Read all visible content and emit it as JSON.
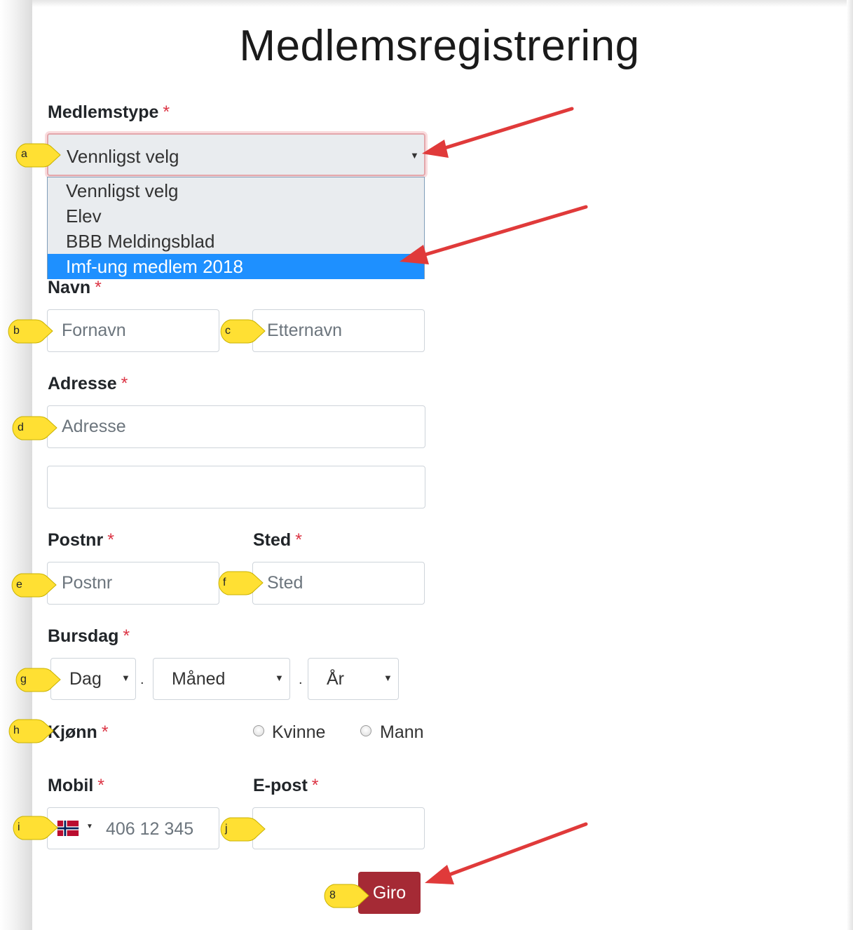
{
  "page": {
    "title": "Medlemsregistrering"
  },
  "medlemstype": {
    "label": "Medlemstype",
    "selected": "Vennligst velg",
    "options": [
      "Vennligst velg",
      "Elev",
      "BBB Meldingsblad",
      "Imf-ung medlem 2018"
    ],
    "highlighted": "Imf-ung medlem 2018"
  },
  "navn": {
    "label": "Navn",
    "first_placeholder": "Fornavn",
    "last_placeholder": "Etternavn"
  },
  "adresse": {
    "label": "Adresse",
    "line1_placeholder": "Adresse",
    "line2_placeholder": ""
  },
  "postnr": {
    "label": "Postnr",
    "placeholder": "Postnr"
  },
  "sted": {
    "label": "Sted",
    "placeholder": "Sted"
  },
  "bursdag": {
    "label": "Bursdag",
    "day": "Dag",
    "month": "Måned",
    "year": "År",
    "separator": "."
  },
  "kjonn": {
    "label": "Kjønn",
    "options": [
      "Kvinne",
      "Mann"
    ]
  },
  "mobil": {
    "label": "Mobil",
    "placeholder": "406 12 345",
    "country": "Norway"
  },
  "epost": {
    "label": "E-post",
    "placeholder": ""
  },
  "required_marker": "*",
  "submit": {
    "label": "Giro"
  },
  "callouts": {
    "a": "a",
    "b": "b",
    "c": "c",
    "d": "d",
    "e": "e",
    "f": "f",
    "g": "g",
    "h": "h",
    "i": "i",
    "j": "j",
    "k": "8"
  },
  "colors": {
    "required": "#dc3545",
    "highlight": "#1e90ff",
    "button": "#a52a35",
    "callout": "#ffe033",
    "arrow": "#e03a3a"
  }
}
